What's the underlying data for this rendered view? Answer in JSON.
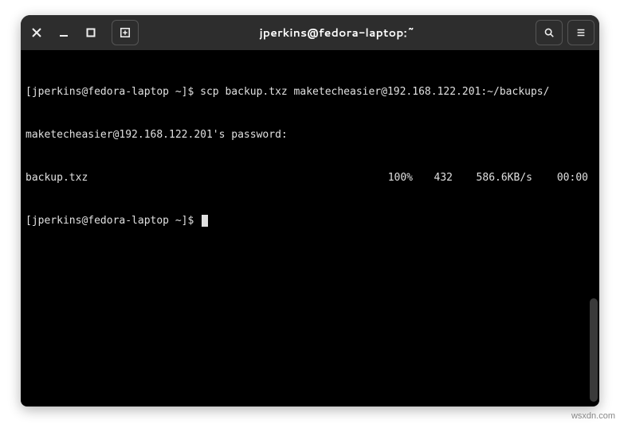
{
  "window": {
    "title": "jperkins@fedora-laptop:~"
  },
  "terminal": {
    "line1_prompt": "[jperkins@fedora-laptop ~]$ ",
    "line1_cmd": "scp backup.txz maketecheasier@192.168.122.201:~/backups/",
    "line2": "maketecheasier@192.168.122.201's password:",
    "line3_file": "backup.txz",
    "line3_pct": "100%",
    "line3_size": "432",
    "line3_speed": "586.6KB/s",
    "line3_eta": "00:00",
    "line4_prompt": "[jperkins@fedora-laptop ~]$ "
  },
  "watermark": "wsxdn.com"
}
